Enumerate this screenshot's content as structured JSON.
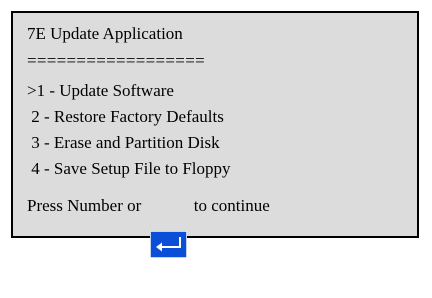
{
  "app": {
    "title": "7E Update Application",
    "divider": "=================="
  },
  "menu": {
    "items": [
      {
        "label": ">1 - Update Software"
      },
      {
        "label": " 2 - Restore Factory Defaults"
      },
      {
        "label": " 3 - Erase and Partition Disk"
      },
      {
        "label": " 4 - Save Setup File to Floppy"
      }
    ]
  },
  "prompt": {
    "before": "Press Number or ",
    "after": " to continue",
    "key_icon": "enter-key-icon"
  },
  "colors": {
    "panel_background": "#dcdcdc",
    "border": "#000000",
    "key_fill": "#0b4fd8"
  }
}
